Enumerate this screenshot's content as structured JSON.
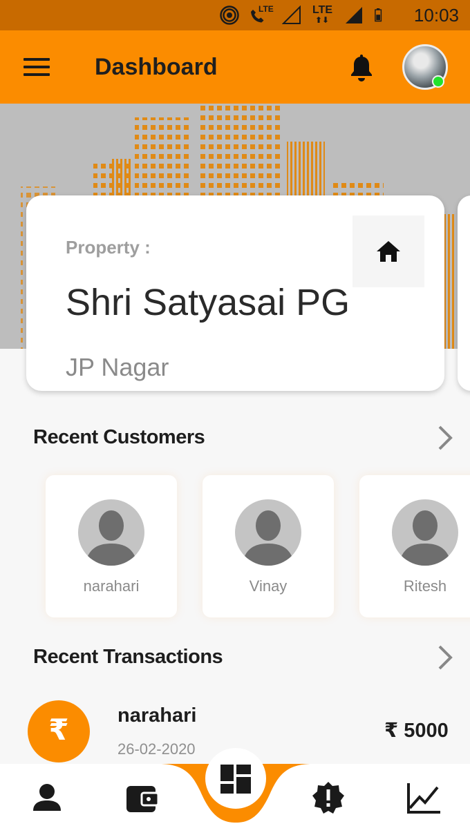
{
  "status_bar": {
    "time": "10:03",
    "lte1": "LTE",
    "lte2": "LTE"
  },
  "app_bar": {
    "title": "Dashboard"
  },
  "property": {
    "label": "Property :",
    "name": "Shri Satyasai PG",
    "location": "JP Nagar"
  },
  "customers": {
    "title": "Recent Customers",
    "items": [
      {
        "name": "narahari"
      },
      {
        "name": "Vinay"
      },
      {
        "name": "Ritesh"
      }
    ]
  },
  "transactions": {
    "title": "Recent Transactions",
    "items": [
      {
        "name": "narahari",
        "date": "26-02-2020",
        "amount": "₹ 5000",
        "icon": "₹"
      }
    ]
  },
  "colors": {
    "accent": "#fb8c00",
    "status_bar": "#c86a00",
    "online": "#22e22b"
  },
  "icons": {
    "menu": "hamburger-icon",
    "bell": "bell-icon",
    "home": "home-icon",
    "chevron": "chevron-right-icon",
    "nav": [
      "person-icon",
      "wallet-icon",
      "dashboard-icon",
      "alert-badge-icon",
      "chart-icon"
    ]
  }
}
